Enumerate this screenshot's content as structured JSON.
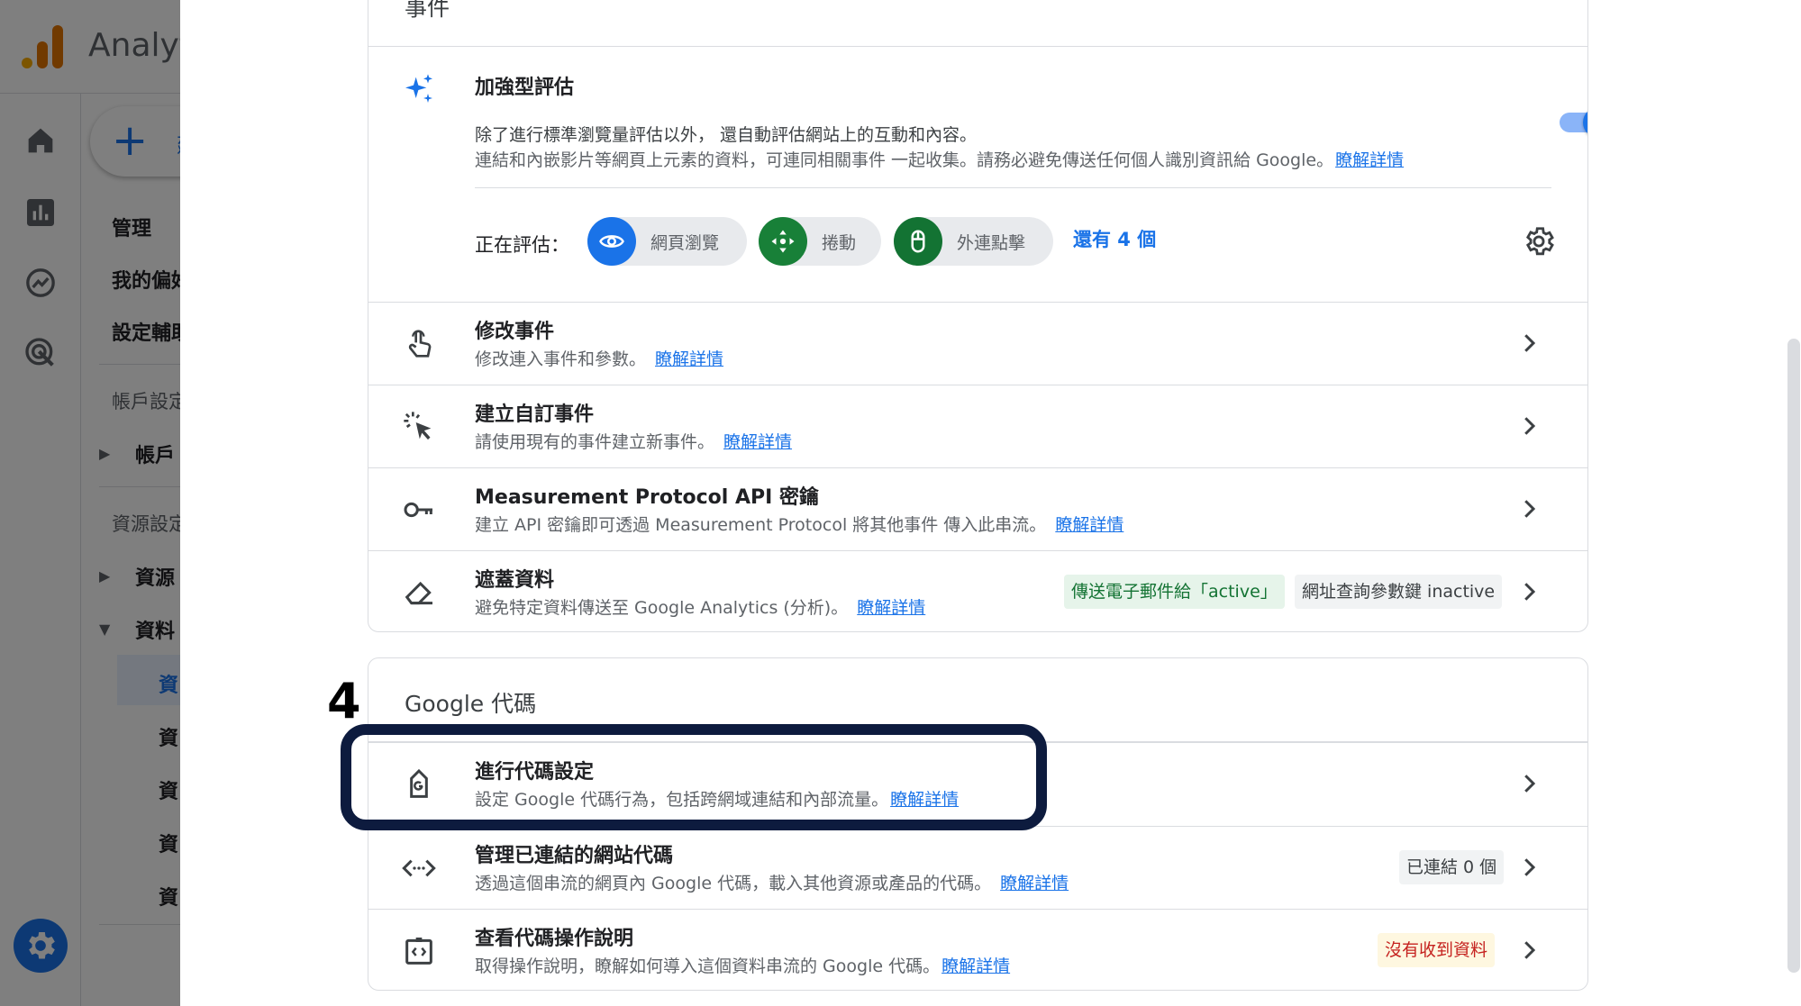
{
  "app": {
    "title": "Analytics",
    "title_visible": "Analyt",
    "logo_colors": [
      "#f9ab00",
      "#e37400",
      "#e37400"
    ]
  },
  "nav_rail": {
    "icons": [
      "home-icon",
      "reports-icon",
      "explore-icon",
      "advertising-icon"
    ],
    "admin_icon": "gear-icon"
  },
  "left_nav": {
    "create_label_visible": "建",
    "items": [
      {
        "label": "管理",
        "kind": "heading"
      },
      {
        "label": "我的偏好",
        "visible": "我的偏好"
      },
      {
        "label": "設定輔助",
        "visible": "設定輔助"
      },
      {
        "label": "帳戶設定",
        "visible": "帳戶設定"
      },
      {
        "label": "帳戶",
        "visible": "帳戶"
      },
      {
        "label": "資源設定",
        "visible": "資源設定"
      },
      {
        "label": "資源",
        "visible": "資源"
      },
      {
        "label": "資料",
        "visible": "資料"
      },
      {
        "label": "資",
        "visible": "資"
      },
      {
        "label": "資",
        "visible": "資"
      },
      {
        "label": "資",
        "visible": "資"
      },
      {
        "label": "資",
        "visible": "資"
      },
      {
        "label": "資",
        "visible": "資"
      }
    ]
  },
  "events_card": {
    "header": "事件",
    "enhanced": {
      "title": "加強型評估",
      "desc1": "除了進行標準瀏覽量評估以外， 還自動評估網站上的互動和內容。",
      "desc2": "連結和內嵌影片等網頁上元素的資料，可連同相關事件 一起收集。請務必避免傳送任何個人識別資訊給 Google。",
      "learn_more": "瞭解詳情",
      "enabled": true,
      "measuring_label": "正在評估：",
      "pills": [
        {
          "label": "網頁瀏覽",
          "icon": "eye-icon",
          "color": "#1a73e8"
        },
        {
          "label": "捲動",
          "icon": "scroll-arrows-icon",
          "color": "#188038"
        },
        {
          "label": "外連點擊",
          "icon": "mouse-icon",
          "color": "#137333"
        }
      ],
      "more": "還有 4 個"
    },
    "rows": [
      {
        "title": "修改事件",
        "desc": "修改連入事件和參數。",
        "link": "瞭解詳情",
        "icon": "touch-icon"
      },
      {
        "title": "建立自訂事件",
        "desc": "請使用現有的事件建立新事件。",
        "link": "瞭解詳情",
        "icon": "click-sparkle-icon"
      },
      {
        "title": "Measurement Protocol API 密鑰",
        "desc": "建立 API 密鑰即可透過 Measurement Protocol 將其他事件 傳入此串流。",
        "link": "瞭解詳情",
        "icon": "key-icon"
      },
      {
        "title": "遮蓋資料",
        "desc": "避免特定資料傳送至 Google Analytics (分析)。",
        "link": "瞭解詳情",
        "icon": "eraser-icon",
        "chips": [
          {
            "label": "傳送電子郵件給「active」",
            "color": "#137333",
            "bg": "#e6f4ea"
          },
          {
            "label": "網址查詢參數鍵 inactive",
            "color": "#3c4043",
            "bg": "#f1f3f4"
          }
        ]
      }
    ]
  },
  "tag_card": {
    "header": "Google 代碼",
    "rows": [
      {
        "title": "進行代碼設定",
        "desc": "設定 Google 代碼行為，包括跨網域連結和內部流量。",
        "link": "瞭解詳情",
        "icon": "google-tag-icon"
      },
      {
        "title": "管理已連結的網站代碼",
        "desc": "透過這個串流的網頁內 Google 代碼，載入其他資源或產品的代碼。",
        "link": "瞭解詳情",
        "icon": "code-arrows-icon",
        "chip": {
          "label": "已連結 0 個",
          "color": "#3c4043",
          "bg": "#f1f3f4"
        }
      },
      {
        "title": "查看代碼操作說明",
        "desc": "取得操作說明，瞭解如何導入這個資料串流的 Google 代碼。",
        "link": "瞭解詳情",
        "icon": "code-box-icon",
        "chip": {
          "label": "沒有收到資料",
          "color": "#c5221f",
          "bg": "#fef7e0"
        }
      }
    ]
  },
  "annotation": {
    "step": "4"
  }
}
